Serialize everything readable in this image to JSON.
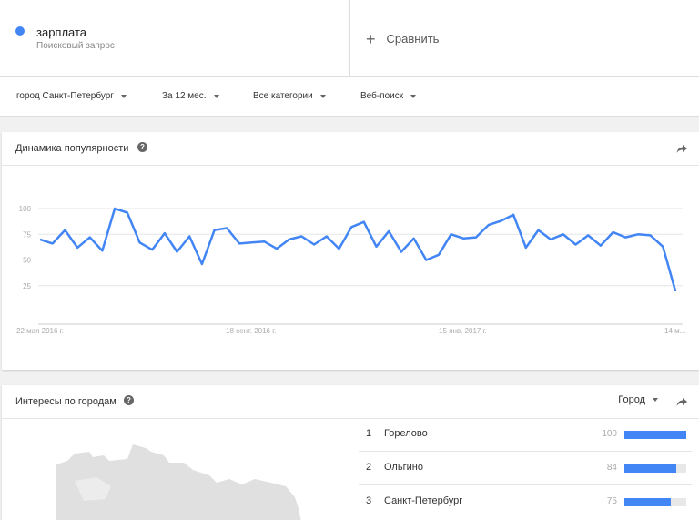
{
  "search_term": {
    "name": "зарплата",
    "type": "Поисковый запрос",
    "color": "#4285f4"
  },
  "compare": {
    "plus": "+",
    "label": "Сравнить"
  },
  "filters": [
    {
      "label": "город Санкт-Петербург"
    },
    {
      "label": "За 12 мес."
    },
    {
      "label": "Все категории"
    },
    {
      "label": "Веб-поиск"
    }
  ],
  "interest_over_time": {
    "title": "Динамика популярности",
    "help": "?"
  },
  "chart_data": {
    "type": "line",
    "title": "",
    "xlabel": "",
    "ylabel": "",
    "ylim": [
      0,
      100
    ],
    "yticks": [
      "100",
      "75",
      "50",
      "25"
    ],
    "xtick_labels": [
      "22 мая 2016 г.",
      "18 сент. 2016 г.",
      "15 янв. 2017 г.",
      "14 м..."
    ],
    "grid": true,
    "series": [
      {
        "color": "#4285f4",
        "values": [
          70,
          66,
          79,
          62,
          72,
          59,
          100,
          96,
          67,
          60,
          76,
          58,
          73,
          46,
          79,
          81,
          66,
          67,
          68,
          61,
          70,
          73,
          65,
          73,
          61,
          82,
          87,
          63,
          78,
          58,
          71,
          50,
          55,
          75,
          71,
          72,
          84,
          88,
          94,
          62,
          79,
          70,
          75,
          65,
          74,
          64,
          77,
          72,
          75,
          74,
          63,
          20
        ]
      }
    ]
  },
  "interest_by_region": {
    "title": "Интересы по городам",
    "help": "?",
    "resolution_label": "Город",
    "rows": [
      {
        "rank": "1",
        "name": "Горелово",
        "value": 100
      },
      {
        "rank": "2",
        "name": "Ольгино",
        "value": 84
      },
      {
        "rank": "3",
        "name": "Санкт-Петербург",
        "value": 75
      }
    ]
  }
}
